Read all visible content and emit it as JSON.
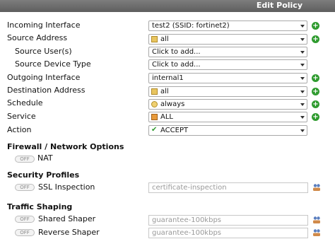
{
  "header": {
    "title": "Edit Policy"
  },
  "form": {
    "incoming_interface": {
      "label": "Incoming Interface",
      "value": "test2 (SSID: fortinet2)"
    },
    "source_address": {
      "label": "Source Address",
      "value": "all"
    },
    "source_users": {
      "label": "Source User(s)",
      "placeholder": "Click to add..."
    },
    "source_device_type": {
      "label": "Source Device Type",
      "placeholder": "Click to add..."
    },
    "outgoing_interface": {
      "label": "Outgoing Interface",
      "value": "internal1"
    },
    "destination_address": {
      "label": "Destination Address",
      "value": "all"
    },
    "schedule": {
      "label": "Schedule",
      "value": "always"
    },
    "service": {
      "label": "Service",
      "value": "ALL"
    },
    "action": {
      "label": "Action",
      "value": "ACCEPT"
    }
  },
  "firewall_options": {
    "title": "Firewall / Network Options",
    "nat": {
      "label": "NAT",
      "state": "OFF"
    }
  },
  "security_profiles": {
    "title": "Security Profiles",
    "ssl": {
      "label": "SSL Inspection",
      "state": "OFF",
      "value": "certificate-inspection"
    }
  },
  "traffic_shaping": {
    "title": "Traffic Shaping",
    "shared": {
      "label": "Shared Shaper",
      "state": "OFF",
      "value": "guarantee-100kbps"
    },
    "reverse": {
      "label": "Reverse Shaper",
      "state": "OFF",
      "value": "guarantee-100kbps"
    }
  },
  "colors": {
    "header_bg": "#6b6b6b",
    "add_green": "#2f9b2f",
    "accept_green": "#2e9b2e"
  },
  "icons": [
    "plus-icon",
    "address-icon",
    "schedule-icon",
    "service-icon",
    "check-icon",
    "object-picker-icon",
    "dropdown-arrow-icon"
  ]
}
